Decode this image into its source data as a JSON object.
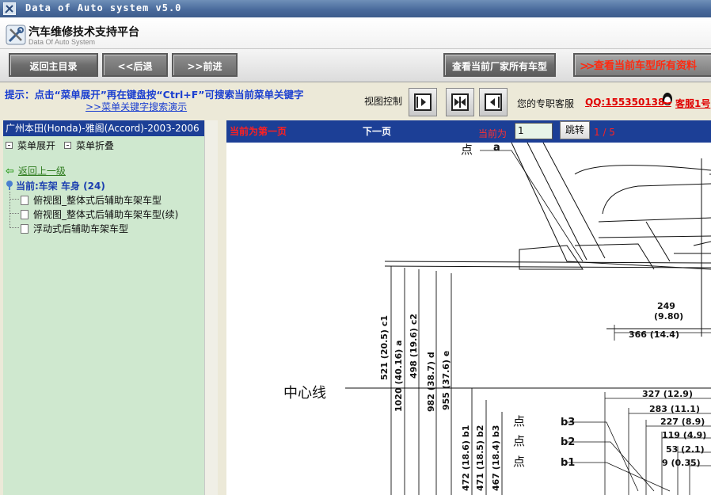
{
  "window": {
    "title": "Data of Auto system v5.0"
  },
  "header": {
    "title_cn": "汽车维修技术支持平台",
    "title_en": "Data Of Auto System"
  },
  "toolbar": {
    "back_main": "返回主目录",
    "back": "<<后退",
    "forward": ">>前进",
    "view_all_models": "查看当前厂家所有车型",
    "view_all_data": "查看当前车型所有资料"
  },
  "tips": {
    "hint": "提示：点击“菜单展开”再在键盘按“Ctrl+F”可搜索当前菜单关键字",
    "demo_link": ">>菜单关键字搜索演示",
    "view_control": "视图控制",
    "service_label": "您的专职客服",
    "qq": "QQ:1553501388",
    "service1": "客服1号"
  },
  "left_panel": {
    "model_title": "广州本田(Honda)-雅阁(Accord)-2003-2006",
    "expand": "菜单展开",
    "collapse": "菜单折叠",
    "back_up": "返回上一级",
    "current": "当前:车架 车身 (24)",
    "items": [
      "俯视图_整体式后辅助车架车型",
      "俯视图_整体式后辅助车架车型(续)",
      "浮动式后辅助车架车型"
    ]
  },
  "viewer": {
    "first_page": "当前为第一页",
    "next_page": "下一页",
    "current_label": "当前为",
    "page_value": "1",
    "jump": "跳转",
    "page_count": "1 / 5"
  },
  "drawing": {
    "center_line": "中心线",
    "point_labels": [
      "点",
      "a",
      "点",
      "b3",
      "点",
      "b2",
      "点",
      "b1"
    ],
    "vertical_dims": [
      "521 (20.5) c1",
      "1020 (40.16) a",
      "498 (19.6) c2",
      "982 (38.7) d",
      "955 (37.6) e",
      "472 (18.6) b1",
      "471 (18.5) b2",
      "467 (18.4) b3"
    ],
    "horizontal_dims": [
      "249",
      "(9.80)",
      "366 (14.4)",
      "327 (12.9)",
      "283 (11.1)",
      "227 (8.9)",
      "119 (4.9)",
      "53 (2.1)",
      "9 (0.35)"
    ]
  },
  "colors": {
    "title_bar": "#4a6b9c",
    "panel_header": "#1c3f96",
    "left_bg": "#cfe8cf",
    "link_blue": "#1b3fd0",
    "alert_red": "#e00000"
  }
}
